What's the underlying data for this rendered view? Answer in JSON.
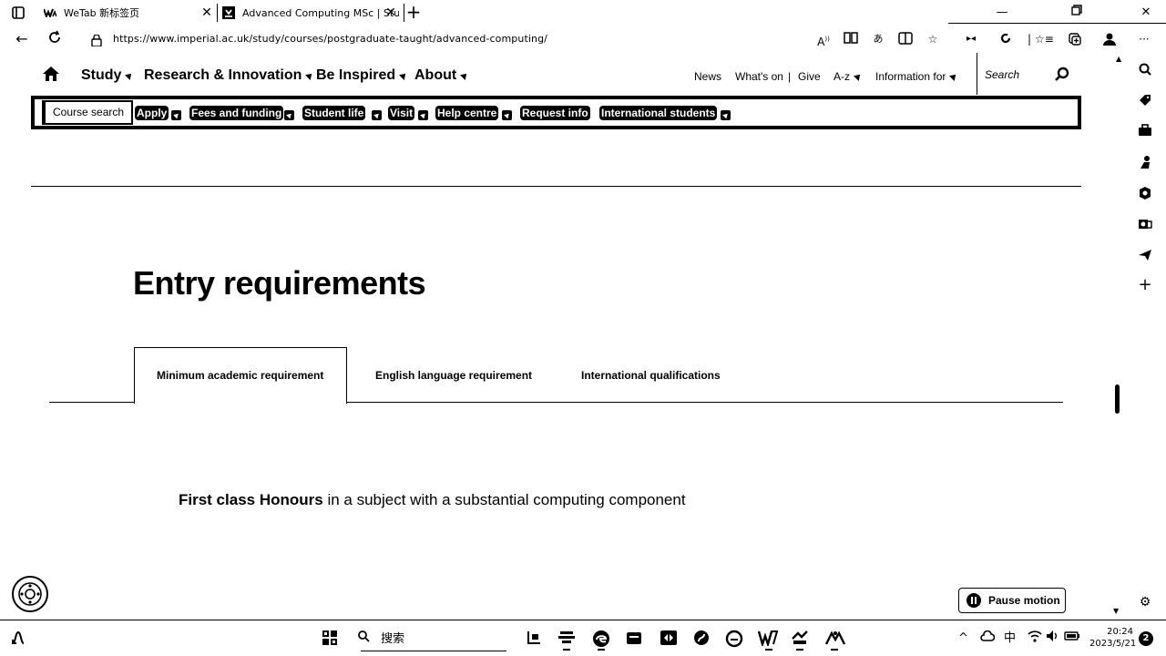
{
  "browser": {
    "tabs": [
      {
        "title": "WeTab 新标签页"
      },
      {
        "title": "Advanced Computing MSc | Stuc"
      }
    ],
    "new_tab": "+",
    "url": "https://www.imperial.ac.uk/study/courses/postgraduate-taught/advanced-computing/"
  },
  "site": {
    "main_nav": [
      "Study",
      "Research & Innovation",
      "Be Inspired",
      "About"
    ],
    "utility_nav": {
      "news": "News",
      "whats_on": "What's on",
      "separator": "|",
      "give": "Give",
      "az": "A-z",
      "information_for": "Information for"
    },
    "search_placeholder": "Search",
    "sub_nav": {
      "course_search": "Course search",
      "items": [
        "Apply",
        "Fees and funding",
        "Student life",
        "Visit",
        "Help centre",
        "Request info",
        "International students"
      ]
    }
  },
  "content": {
    "heading": "Entry requirements",
    "tabs": [
      "Minimum academic requirement",
      "English language requirement",
      "International qualifications"
    ],
    "active_tab": "Minimum academic requirement",
    "requirement_bold": "First class Honours",
    "requirement_rest": " in a subject with a substantial computing component",
    "pause_motion": "Pause motion"
  },
  "taskbar": {
    "search_label": "搜索",
    "ime": "中",
    "time": "20:24",
    "date": "2023/5/21",
    "notifications": "2"
  }
}
